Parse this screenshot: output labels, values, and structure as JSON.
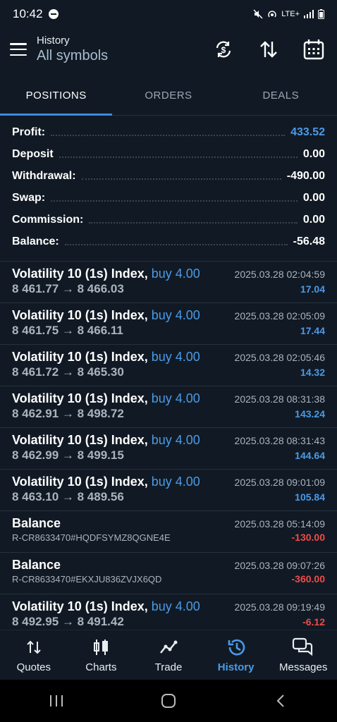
{
  "status_bar": {
    "time": "10:42",
    "network": "LTE+"
  },
  "app_bar": {
    "title": "History",
    "subtitle": "All symbols"
  },
  "tabs": [
    {
      "label": "POSITIONS",
      "active": true
    },
    {
      "label": "ORDERS",
      "active": false
    },
    {
      "label": "DEALS",
      "active": false
    }
  ],
  "summary": {
    "profit": {
      "label": "Profit:",
      "value": "433.52"
    },
    "deposit": {
      "label": "Deposit",
      "value": "0.00"
    },
    "withdrawal": {
      "label": "Withdrawal:",
      "value": "-490.00"
    },
    "swap": {
      "label": "Swap:",
      "value": "0.00"
    },
    "commission": {
      "label": "Commission:",
      "value": "0.00"
    },
    "balance": {
      "label": "Balance:",
      "value": "-56.48"
    }
  },
  "items": [
    {
      "title": "Volatility 10 (1s) Index,",
      "side": "buy 4.00",
      "date": "2025.03.28 02:04:59",
      "prices": "8 461.77 → 8 466.03",
      "profit": "17.04"
    },
    {
      "title": "Volatility 10 (1s) Index,",
      "side": "buy 4.00",
      "date": "2025.03.28 02:05:09",
      "prices": "8 461.75 → 8 466.11",
      "profit": "17.44"
    },
    {
      "title": "Volatility 10 (1s) Index,",
      "side": "buy 4.00",
      "date": "2025.03.28 02:05:46",
      "prices": "8 461.72 → 8 465.30",
      "profit": "14.32"
    },
    {
      "title": "Volatility 10 (1s) Index,",
      "side": "buy 4.00",
      "date": "2025.03.28 08:31:38",
      "prices": "8 462.91 → 8 498.72",
      "profit": "143.24"
    },
    {
      "title": "Volatility 10 (1s) Index,",
      "side": "buy 4.00",
      "date": "2025.03.28 08:31:43",
      "prices": "8 462.99 → 8 499.15",
      "profit": "144.64"
    },
    {
      "title": "Volatility 10 (1s) Index,",
      "side": "buy 4.00",
      "date": "2025.03.28 09:01:09",
      "prices": "8 463.10 → 8 489.56",
      "profit": "105.84"
    },
    {
      "title": "Balance",
      "date": "2025.03.28 05:14:09",
      "comment": "R-CR8633470#HQDFSYMZ8QGNE4E",
      "profit": "-130.00"
    },
    {
      "title": "Balance",
      "date": "2025.03.28 09:07:26",
      "comment": "R-CR8633470#EKXJU836ZVJX6QD",
      "profit": "-360.00"
    },
    {
      "title": "Volatility 10 (1s) Index,",
      "side": "buy 4.00",
      "date": "2025.03.28 09:19:49",
      "prices": "8 492.95 → 8 491.42",
      "profit": "-6.12"
    }
  ],
  "bottom_nav": [
    {
      "label": "Quotes",
      "icon": "quotes-icon",
      "active": false
    },
    {
      "label": "Charts",
      "icon": "charts-icon",
      "active": false
    },
    {
      "label": "Trade",
      "icon": "trade-icon",
      "active": false
    },
    {
      "label": "History",
      "icon": "history-icon",
      "active": true
    },
    {
      "label": "Messages",
      "icon": "messages-icon",
      "active": false
    }
  ],
  "colors": {
    "accent": "#4b9ae8",
    "negative": "#ef4b4b",
    "background": "#111a24"
  }
}
